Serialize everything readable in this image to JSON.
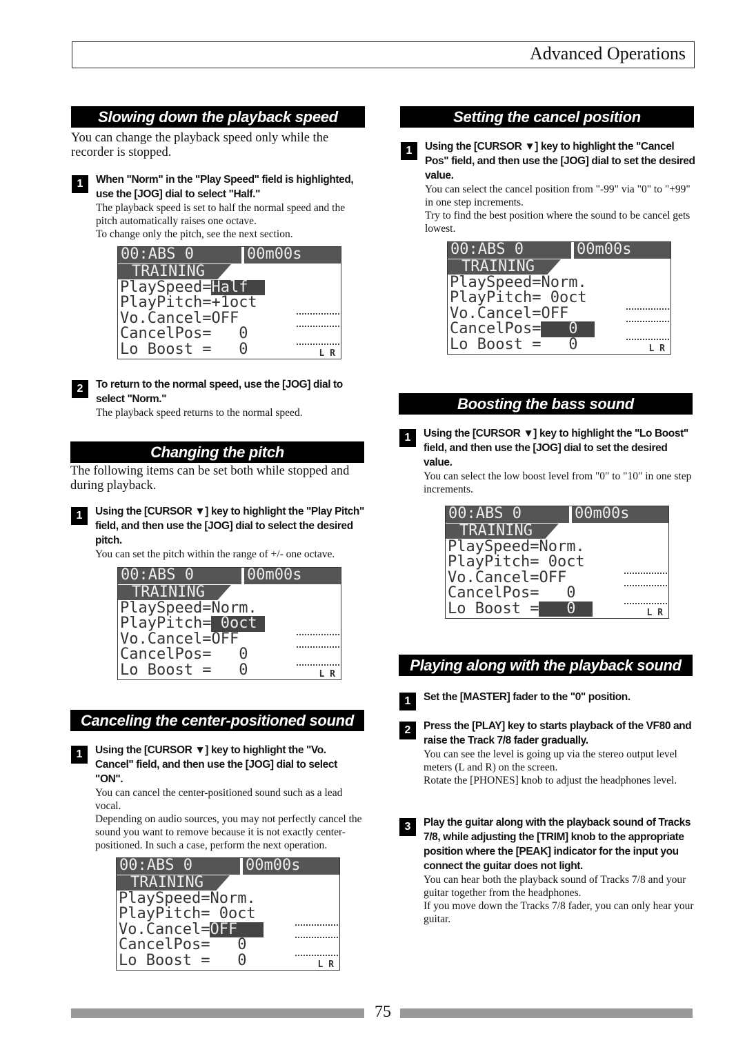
{
  "header": {
    "title": "Advanced Operations"
  },
  "page_number": "75",
  "sections": [
    {
      "id": "slow",
      "title": "Slowing down the playback speed",
      "intro": "You can change the playback speed only while the recorder is stopped.",
      "steps": [
        {
          "num": "1",
          "bold": "When \"Norm\" in the \"Play Speed\" field is highlighted, use the [JOG] dial to select \"Half.\"",
          "body": [
            "The playback speed is set to half the normal speed and the pitch automatically raises one octave.",
            "To change only the pitch, see the next section."
          ]
        },
        {
          "num": "2",
          "bold": "To return to the normal speed, use the [JOG] dial to select \"Norm.\"",
          "body": [
            "The playback speed returns to the normal speed."
          ]
        }
      ]
    },
    {
      "id": "pitch",
      "title": "Changing the pitch",
      "intro": "The following items can be set both while stopped and during playback.",
      "steps": [
        {
          "num": "1",
          "bold": "Using the [CURSOR ▼] key to highlight the \"Play Pitch\" field, and then use the [JOG] dial to select the desired pitch.",
          "body": [
            "You can set the pitch within the range of +/- one octave."
          ]
        }
      ]
    },
    {
      "id": "cancel",
      "title": "Canceling the center-positioned sound",
      "intro": "",
      "steps": [
        {
          "num": "1",
          "bold": "Using the [CURSOR ▼] key to highlight the \"Vo. Cancel\" field, and then use the [JOG] dial to select \"ON\".",
          "body": [
            "You can cancel the center-positioned sound such as a lead vocal.",
            "Depending on audio sources, you may not perfectly cancel the sound you want to remove because it is not exactly center-positioned.  In such a case, perform the next operation."
          ]
        }
      ]
    },
    {
      "id": "cancelpos",
      "title": "Setting the cancel position",
      "intro": "",
      "steps": [
        {
          "num": "1",
          "bold": "Using the [CURSOR ▼] key to highlight the \"Cancel Pos\" field, and then use the [JOG] dial to set the desired value.",
          "body": [
            "You can select the cancel position from \"-99\" via \"0\" to \"+99\" in one step increments.",
            "Try to find the best position where the sound to be cancel gets lowest."
          ]
        }
      ]
    },
    {
      "id": "bass",
      "title": "Boosting the bass sound",
      "intro": "",
      "steps": [
        {
          "num": "1",
          "bold": "Using the [CURSOR ▼] key to highlight the \"Lo Boost\" field, and then use the [JOG] dial to set the desired value.",
          "body": [
            "You can select the low boost level from \"0\" to \"10\" in one step increments."
          ]
        }
      ]
    },
    {
      "id": "play",
      "title": "Playing along with the playback sound",
      "intro": "",
      "steps": [
        {
          "num": "1",
          "bold": "Set the [MASTER] fader to the \"0\" position.",
          "body": []
        },
        {
          "num": "2",
          "bold": "Press the [PLAY] key to starts playback of the VF80 and raise the Track 7/8 fader gradually.",
          "body": [
            "You can see the level is going up via the stereo output level meters (L and R) on the screen.",
            "Rotate the [PHONES] knob to adjust the headphones level."
          ]
        },
        {
          "num": "3",
          "bold": "Play the guitar along with the playback sound of Tracks 7/8, while adjusting the [TRIM] knob to the appropriate position where the [PEAK] indicator for the input you connect the guitar does not light.",
          "body": [
            "You can hear both the playback sound of Tracks 7/8 and your guitar together from the headphones.",
            "If you move down the Tracks 7/8 fader, you can only hear your guitar."
          ]
        }
      ]
    }
  ],
  "lcds": [
    {
      "top_left": "00:ABS 0",
      "top_right": "00m00s",
      "mode": "TRAINING",
      "rows": [
        [
          "PlaySpeed=",
          "Half"
        ],
        [
          "PlayPitch=",
          "+1oct"
        ],
        [
          "Vo.Cancel=",
          "OFF"
        ],
        [
          "CancelPos=",
          "   0"
        ],
        [
          "Lo Boost =",
          "   0"
        ]
      ],
      "highlight": 0,
      "meter_labels": "L  R"
    },
    {
      "top_left": "00:ABS 0",
      "top_right": "00m00s",
      "mode": "TRAINING",
      "rows": [
        [
          "PlaySpeed=",
          "Norm."
        ],
        [
          "PlayPitch=",
          " 0oct"
        ],
        [
          "Vo.Cancel=",
          "OFF"
        ],
        [
          "CancelPos=",
          "   0"
        ],
        [
          "Lo Boost =",
          "   0"
        ]
      ],
      "highlight": 1,
      "meter_labels": "L  R"
    },
    {
      "top_left": "00:ABS 0",
      "top_right": "00m00s",
      "mode": "TRAINING",
      "rows": [
        [
          "PlaySpeed=",
          "Norm."
        ],
        [
          "PlayPitch=",
          " 0oct"
        ],
        [
          "Vo.Cancel=",
          "OFF"
        ],
        [
          "CancelPos=",
          "   0"
        ],
        [
          "Lo Boost =",
          "   0"
        ]
      ],
      "highlight": 2,
      "meter_labels": "L  R"
    },
    {
      "top_left": "00:ABS 0",
      "top_right": "00m00s",
      "mode": "TRAINING",
      "rows": [
        [
          "PlaySpeed=",
          "Norm."
        ],
        [
          "PlayPitch=",
          " 0oct"
        ],
        [
          "Vo.Cancel=",
          "OFF"
        ],
        [
          "CancelPos=",
          "   0"
        ],
        [
          "Lo Boost =",
          "   0"
        ]
      ],
      "highlight": 3,
      "meter_labels": "L  R"
    },
    {
      "top_left": "00:ABS 0",
      "top_right": "00m00s",
      "mode": "TRAINING",
      "rows": [
        [
          "PlaySpeed=",
          "Norm."
        ],
        [
          "PlayPitch=",
          " 0oct"
        ],
        [
          "Vo.Cancel=",
          "OFF"
        ],
        [
          "CancelPos=",
          "   0"
        ],
        [
          "Lo Boost =",
          "   0"
        ]
      ],
      "highlight": 4,
      "meter_labels": "L  R"
    }
  ]
}
